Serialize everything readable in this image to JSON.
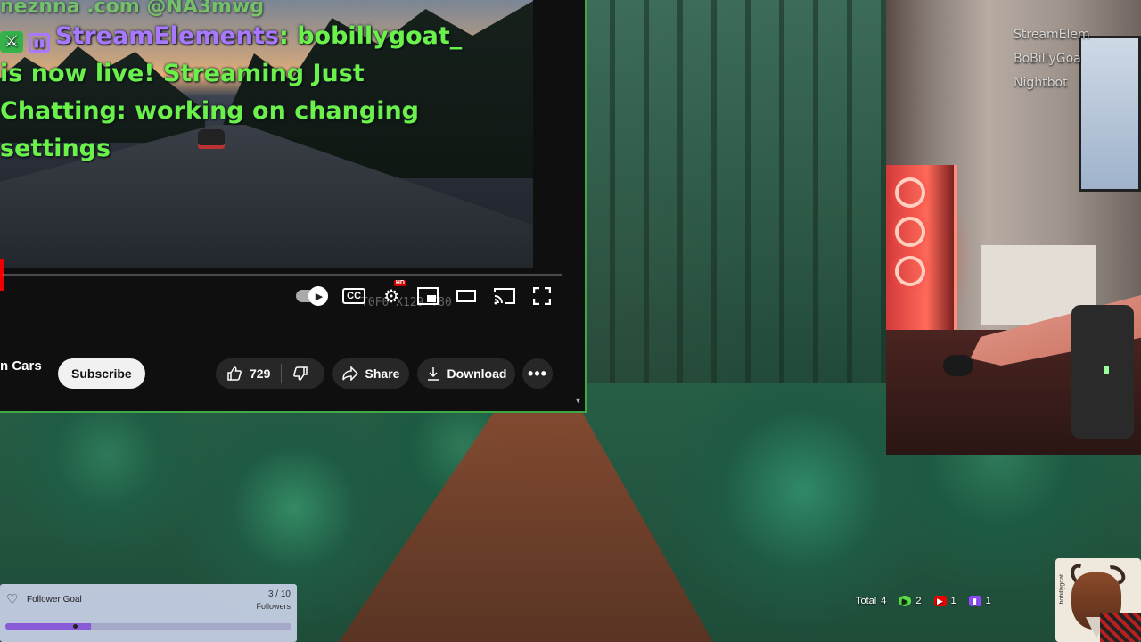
{
  "chat": {
    "line0": "neznna .com @NA3mwg",
    "name": "StreamElements",
    "message_user": ": bobillygoat_",
    "line2": "is now live! Streaming Just",
    "line3": "Chatting: working on changing",
    "line4": "settings"
  },
  "player": {
    "progress_fraction": 0.005,
    "controls": {
      "cc_label": "CC",
      "hd_label": "HD"
    },
    "overlay_caption": "T0F0 X129 T80"
  },
  "video_info": {
    "channel_name": "n Cars",
    "subscribe_label": "Subscribe",
    "like_count": "729",
    "share_label": "Share",
    "download_label": "Download"
  },
  "webcam": {
    "labels": [
      "StreamElem",
      "BoBillyGoa",
      "Nightbot"
    ]
  },
  "follower_goal": {
    "title": "Follower Goal",
    "count": "3 / 10",
    "unit": "Followers",
    "progress_fraction": 0.3
  },
  "viewer_counts": {
    "total_label": "Total",
    "total": "4",
    "rumble": "2",
    "youtube": "1",
    "twitch": "1"
  },
  "logo": {
    "text": "bobillygoat"
  },
  "colors": {
    "chat_green": "#6cf04a",
    "chat_name_purple": "#a978ff",
    "panel_border_green": "#3fa844",
    "goal_bar_purple": "#8a5bd6"
  }
}
